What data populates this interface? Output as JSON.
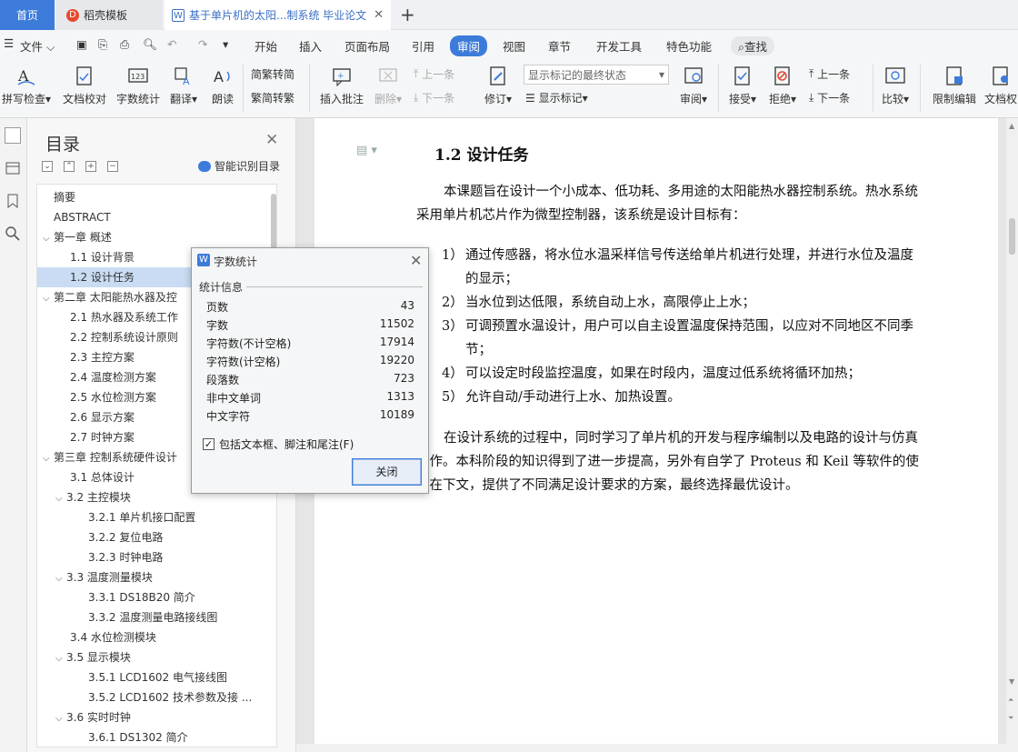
{
  "tabs": {
    "home": "首页",
    "docer": "稻壳模板",
    "doc": "基于单片机的太阳...制系统 毕业论文"
  },
  "menu": {
    "file": "文件",
    "items": [
      "开始",
      "插入",
      "页面布局",
      "引用",
      "审阅",
      "视图",
      "章节",
      "开发工具",
      "特色功能"
    ],
    "search": "查找"
  },
  "ribbon": {
    "spell": "拼写检查",
    "proofread": "文档校对",
    "wordcount": "字数统计",
    "translate": "翻译",
    "read": "朗读",
    "trad": "繁转简",
    "simp": "简转繁",
    "insert_comment": "插入批注",
    "delete": "删除",
    "prev": "上一条",
    "next": "下一条",
    "revise": "修订",
    "show_state": "显示标记的最终状态",
    "show_marks": "显示标记",
    "review": "审阅",
    "accept": "接受",
    "reject": "拒绝",
    "prev2": "上一条",
    "next2": "下一条",
    "compare": "比较",
    "restrict": "限制编辑",
    "docperm": "文档权"
  },
  "toc": {
    "title": "目录",
    "smart": "智能识别目录",
    "entries": [
      {
        "text": "摘要",
        "level": 1,
        "caret": ""
      },
      {
        "text": "ABSTRACT",
        "level": 1,
        "caret": ""
      },
      {
        "text": "第一章   概述",
        "level": 1,
        "caret": "v"
      },
      {
        "text": "1.1    设计背景",
        "level": 2,
        "caret": ""
      },
      {
        "text": "1.2    设计任务",
        "level": 2,
        "caret": "",
        "active": true
      },
      {
        "text": "第二章   太阳能热水器及控",
        "level": 1,
        "caret": "v"
      },
      {
        "text": "2.1    热水器及系统工作",
        "level": 2,
        "caret": ""
      },
      {
        "text": "2.2    控制系统设计原则",
        "level": 2,
        "caret": ""
      },
      {
        "text": "2.3    主控方案",
        "level": 2,
        "caret": ""
      },
      {
        "text": "2.4    温度检测方案",
        "level": 2,
        "caret": ""
      },
      {
        "text": "2.5    水位检测方案",
        "level": 2,
        "caret": ""
      },
      {
        "text": "2.6    显示方案",
        "level": 2,
        "caret": ""
      },
      {
        "text": "2.7    时钟方案",
        "level": 2,
        "caret": ""
      },
      {
        "text": "第三章   控制系统硬件设计",
        "level": 1,
        "caret": "v"
      },
      {
        "text": "3.1    总体设计",
        "level": 2,
        "caret": ""
      },
      {
        "text": "3.2    主控模块",
        "level": 2,
        "caret": "v"
      },
      {
        "text": "3.2.1    单片机接口配置",
        "level": 3,
        "caret": ""
      },
      {
        "text": "3.2.2    复位电路",
        "level": 3,
        "caret": ""
      },
      {
        "text": "3.2.3    时钟电路",
        "level": 3,
        "caret": ""
      },
      {
        "text": "3.3    温度测量模块",
        "level": 2,
        "caret": "v"
      },
      {
        "text": "3.3.1    DS18B20 简介",
        "level": 3,
        "caret": ""
      },
      {
        "text": "3.3.2  温度测量电路接线图",
        "level": 3,
        "caret": ""
      },
      {
        "text": "3.4    水位检测模块",
        "level": 2,
        "caret": ""
      },
      {
        "text": "3.5    显示模块",
        "level": 2,
        "caret": "v"
      },
      {
        "text": "3.5.1    LCD1602 电气接线图",
        "level": 3,
        "caret": ""
      },
      {
        "text": "3.5.2    LCD1602 技术参数及接 ...",
        "level": 3,
        "caret": ""
      },
      {
        "text": "3.6    实时时钟",
        "level": 2,
        "caret": "v"
      },
      {
        "text": "3.6.1    DS1302 简介",
        "level": 3,
        "caret": ""
      }
    ]
  },
  "document": {
    "heading": "1.2   设计任务",
    "intro_line1": "本课题旨在设计一个小成本、低功耗、多用途的太阳能热水器控制系统。热水系统",
    "intro_line2": "采用单片机芯片作为微型控制器，该系统是设计目标有：",
    "items": [
      {
        "num": "1）",
        "line1": "通过传感器，将水位水温采样信号传送给单片机进行处理，并进行水位及温度",
        "line2": "的显示；"
      },
      {
        "num": "2）",
        "line1": "当水位到达低限，系统自动上水，高限停止上水；",
        "line2": ""
      },
      {
        "num": "3）",
        "line1": "可调预置水温设计，用户可以自主设置温度保持范围，以应对不同地区不同季",
        "line2": "节；"
      },
      {
        "num": "4）",
        "line1": "可以设定时段监控温度，如果在时段内，温度过低系统将循环加热；",
        "line2": ""
      },
      {
        "num": "5）",
        "line1": "允许自动/手动进行上水、加热设置。",
        "line2": ""
      }
    ],
    "outro_line1": "在设计系统的过程中，同时学习了单片机的开发与程序编制以及电路的设计与仿真",
    "outro_line2": "操作。本科阶段的知识得到了进一步提高，另外有自学了 Proteus 和 Keil 等软件的使",
    "outro_line3": "。在下文，提供了不同满足设计要求的方案，最终选择最优设计。"
  },
  "dialog": {
    "title": "字数统计",
    "group": "统计信息",
    "stats": [
      {
        "label": "页数",
        "value": "43"
      },
      {
        "label": "字数",
        "value": "11502"
      },
      {
        "label": "字符数(不计空格)",
        "value": "17914"
      },
      {
        "label": "字符数(计空格)",
        "value": "19220"
      },
      {
        "label": "段落数",
        "value": "723"
      },
      {
        "label": "非中文单词",
        "value": "1313"
      },
      {
        "label": "中文字符",
        "value": "10189"
      }
    ],
    "checkbox": "包括文本框、脚注和尾注(F)",
    "checked": true,
    "close_button": "关闭"
  }
}
